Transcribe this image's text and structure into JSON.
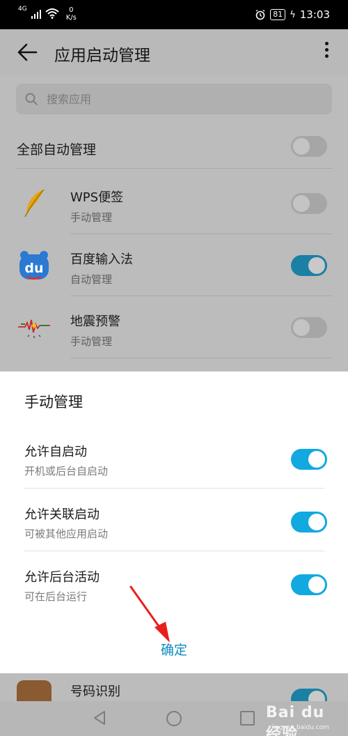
{
  "status_bar": {
    "signal": "4G",
    "speed_value": "0",
    "speed_unit": "K/s",
    "battery": "81",
    "time": "13:03"
  },
  "header": {
    "title": "应用启动管理"
  },
  "search": {
    "placeholder": "搜索应用"
  },
  "all_manage": {
    "label": "全部自动管理",
    "enabled": false
  },
  "apps": [
    {
      "name": "WPS便签",
      "mode": "手动管理",
      "enabled": false,
      "icon": "wps-note-feather-icon"
    },
    {
      "name": "百度输入法",
      "mode": "自动管理",
      "enabled": true,
      "icon": "baidu-input-du-icon"
    },
    {
      "name": "地震预警",
      "mode": "手动管理",
      "enabled": false,
      "icon": "earthquake-wave-icon"
    }
  ],
  "peek_app": {
    "name": "号码识别",
    "enabled": true
  },
  "dialog": {
    "title": "手动管理",
    "options": [
      {
        "title": "允许自启动",
        "subtitle": "开机或后台自启动",
        "enabled": true
      },
      {
        "title": "允许关联启动",
        "subtitle": "可被其他应用启动",
        "enabled": true
      },
      {
        "title": "允许后台活动",
        "subtitle": "可在后台运行",
        "enabled": true
      }
    ],
    "confirm_label": "确定"
  },
  "watermark": {
    "main": "Bai du 经验",
    "url": "jingyan.baidu.com"
  },
  "colors": {
    "accent": "#12a8e0",
    "confirm_text": "#0a8bc0",
    "annotation_arrow": "#e8201a"
  }
}
